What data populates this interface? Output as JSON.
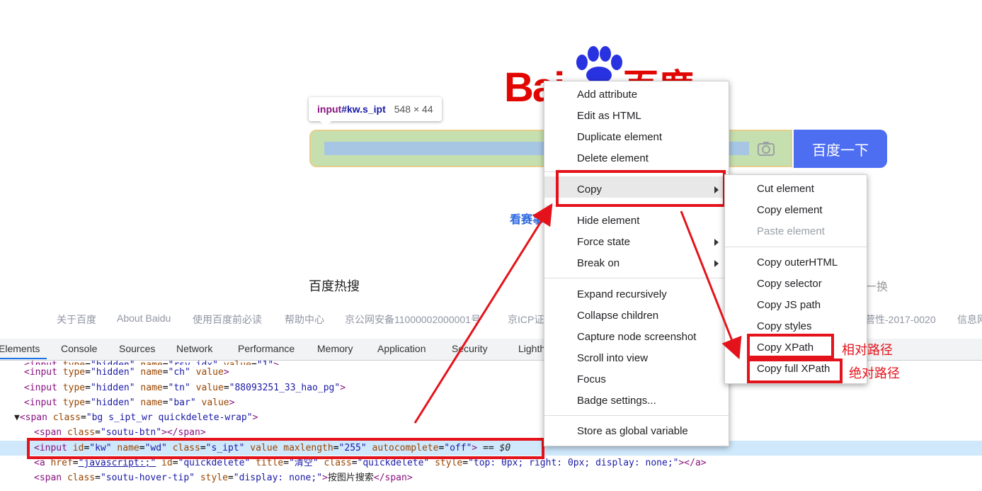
{
  "baidu": {
    "logo_latin": "Bai",
    "logo_cn": "百度",
    "search_button": "百度一下",
    "tooltip_selector_tag": "input",
    "tooltip_selector_id": "#kw.s_ipt",
    "tooltip_size": "548 × 44",
    "link_partial": "看赛事",
    "hot_search": "百度热搜",
    "refresh": "一换",
    "footer": [
      "关于百度",
      "About Baidu",
      "使用百度前必读",
      "帮助中心",
      "京公网安备11000002000001号",
      "京ICP证",
      "营性-2017-0020",
      "信息网"
    ]
  },
  "devtools": {
    "tabs": [
      "Elements",
      "Console",
      "Sources",
      "Network",
      "Performance",
      "Memory",
      "Application",
      "Security",
      "Lighth"
    ],
    "active_tab": "Elements"
  },
  "context_menu": {
    "items": [
      "Add attribute",
      "Edit as HTML",
      "Duplicate element",
      "Delete element",
      "Copy",
      "Hide element",
      "Force state",
      "Break on",
      "Expand recursively",
      "Collapse children",
      "Capture node screenshot",
      "Scroll into view",
      "Focus",
      "Badge settings...",
      "Store as global variable"
    ],
    "submenu": [
      "Cut element",
      "Copy element",
      "Paste element",
      "Copy outerHTML",
      "Copy selector",
      "Copy JS path",
      "Copy styles",
      "Copy XPath",
      "Copy full XPath"
    ]
  },
  "annotations": {
    "relative_path": "相对路径",
    "absolute_path": "绝对路径",
    "color": "#e4131b"
  },
  "colors": {
    "baidu_red": "#e10601",
    "baidu_blue": "#4e6ef2",
    "tag": "#881280",
    "attribute": "#994500",
    "value": "#1a1aa6"
  }
}
